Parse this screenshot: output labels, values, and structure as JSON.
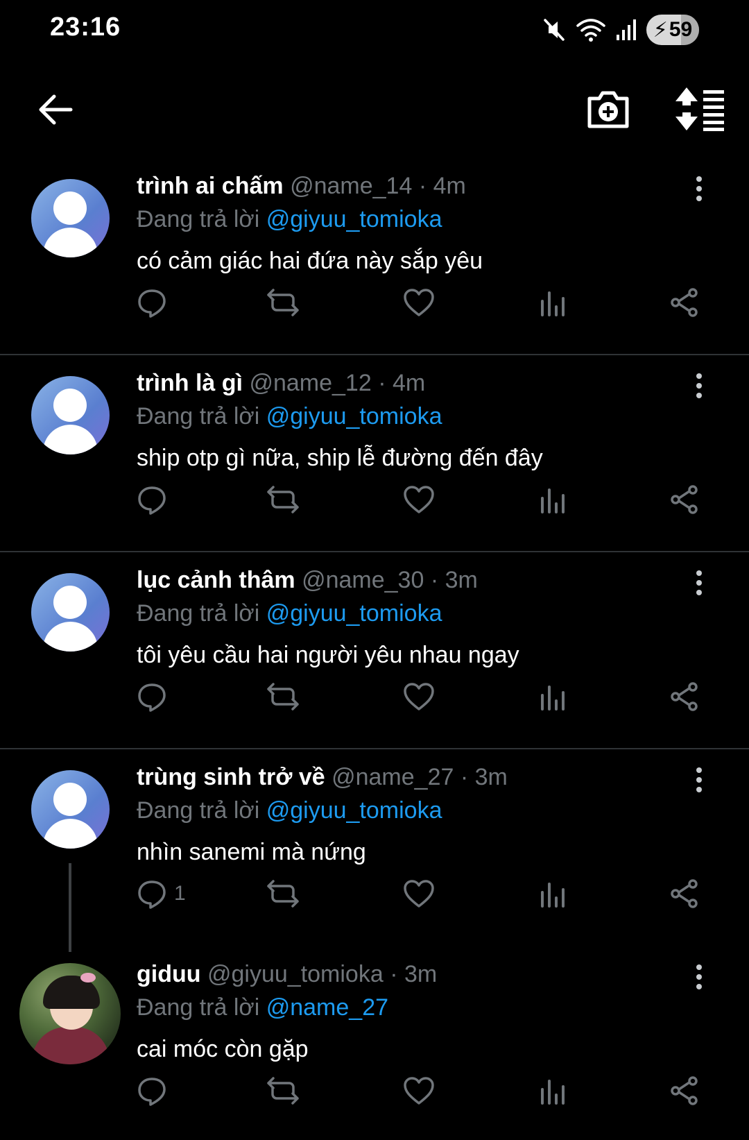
{
  "status_bar": {
    "time": "23:16",
    "battery": "59",
    "icons": [
      "mute-icon",
      "wifi-icon",
      "signal-icon",
      "battery-charging-icon"
    ]
  },
  "nav": {
    "icons": [
      "back-arrow-icon",
      "camera-add-icon",
      "sort-icon"
    ]
  },
  "replying_prefix": "Đang trả lời",
  "replies": [
    {
      "name": "trình ai chấm",
      "handle": "@name_14",
      "dot": "·",
      "time": "4m",
      "reply_to": "@giyuu_tomioka",
      "text": "có cảm giác hai đứa này sắp yêu",
      "reply_count": ""
    },
    {
      "name": "trình là gì",
      "handle": "@name_12",
      "dot": "·",
      "time": "4m",
      "reply_to": "@giyuu_tomioka",
      "text": "ship otp gì nữa, ship lễ đường đến đây",
      "reply_count": ""
    },
    {
      "name": "lục cảnh thâm",
      "handle": "@name_30",
      "dot": "·",
      "time": "3m",
      "reply_to": "@giyuu_tomioka",
      "text": "tôi yêu cầu hai người yêu nhau ngay",
      "reply_count": ""
    },
    {
      "name": "trùng sinh trở về",
      "handle": "@name_27",
      "dot": "·",
      "time": "3m",
      "reply_to": "@giyuu_tomioka",
      "text": "nhìn sanemi mà nứng",
      "reply_count": "1"
    },
    {
      "name": "giduu",
      "handle": "@giyuu_tomioka",
      "dot": "·",
      "time": "3m",
      "reply_to": "@name_27",
      "text": "cai móc còn gặp",
      "reply_count": ""
    }
  ],
  "colors": {
    "background": "#000000",
    "text": "#e7e9ea",
    "muted": "#71767b",
    "mention": "#1d9bf0",
    "divider": "#2f3336"
  }
}
